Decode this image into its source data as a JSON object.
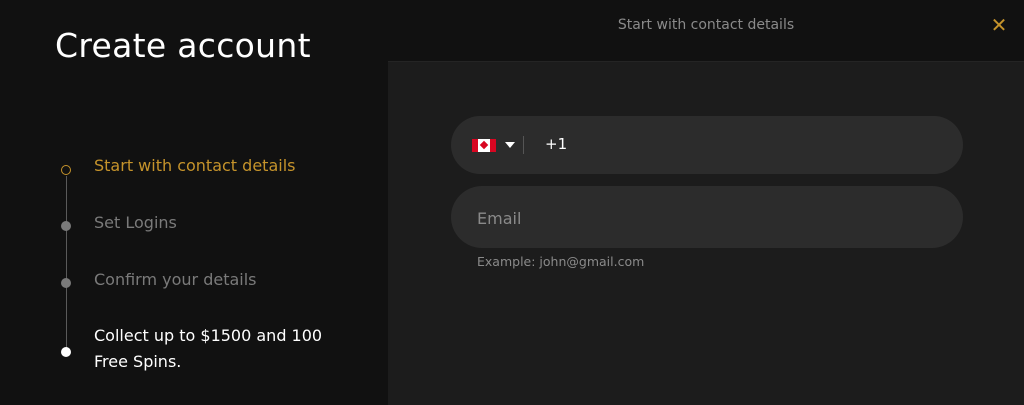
{
  "left": {
    "title": "Create account",
    "steps": [
      {
        "label": "Start with contact details",
        "state": "active"
      },
      {
        "label": "Set Logins",
        "state": "pending"
      },
      {
        "label": "Confirm your details",
        "state": "pending"
      },
      {
        "label": "Collect up to $1500 and 100 Free Spins.",
        "state": "bonus"
      }
    ]
  },
  "header": {
    "title": "Start with contact details",
    "close_icon": "close-icon"
  },
  "form": {
    "phone": {
      "country_flag": "canada-flag-icon",
      "dial_code": "+1"
    },
    "email": {
      "placeholder": "Email",
      "value": "",
      "hint": "Example: john@gmail.com"
    }
  },
  "colors": {
    "accent": "#c5932b",
    "background": "#111111",
    "panel": "#1c1c1c",
    "field": "#2c2c2c",
    "muted_text": "#7a7a7a"
  }
}
